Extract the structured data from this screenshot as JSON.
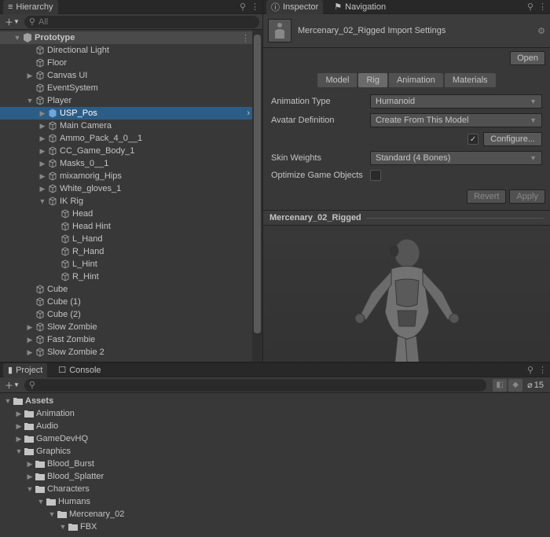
{
  "hierarchy": {
    "tab": "Hierarchy",
    "search_placeholder": "All",
    "scene": "Prototype",
    "items": [
      "Directional Light",
      "Floor",
      "Canvas UI",
      "EventSystem",
      "Player",
      "USP_Pos",
      "Main Camera",
      "Ammo_Pack_4_0__1",
      "CC_Game_Body_1",
      "Masks_0__1",
      "mixamorig_Hips",
      "White_gloves_1",
      "IK Rig",
      "Head",
      "Head Hint",
      "L_Hand",
      "R_Hand",
      "L_Hint",
      "R_Hint",
      "Cube",
      "Cube (1)",
      "Cube (2)",
      "Slow Zombie",
      "Fast Zombie",
      "Slow Zombie 2"
    ]
  },
  "inspector": {
    "tab1": "Inspector",
    "tab2": "Navigation",
    "asset_name": "Mercenary_02_Rigged Import Settings",
    "open": "Open",
    "tabs": {
      "model": "Model",
      "rig": "Rig",
      "anim": "Animation",
      "mats": "Materials"
    },
    "anim_type_label": "Animation Type",
    "anim_type_val": "Humanoid",
    "avatar_label": "Avatar Definition",
    "avatar_val": "Create From This Model",
    "configure": "Configure...",
    "skin_label": "Skin Weights",
    "skin_val": "Standard (4 Bones)",
    "optimize_label": "Optimize Game Objects",
    "revert": "Revert",
    "apply": "Apply",
    "preview_name": "Mercenary_02_Rigged"
  },
  "project": {
    "tab1": "Project",
    "tab2": "Console",
    "count": "15",
    "root": "Assets",
    "folders": [
      "Animation",
      "Audio",
      "GameDevHQ",
      "Graphics",
      "Blood_Burst",
      "Blood_Splatter",
      "Characters",
      "Humans",
      "Mercenary_02",
      "FBX"
    ]
  }
}
